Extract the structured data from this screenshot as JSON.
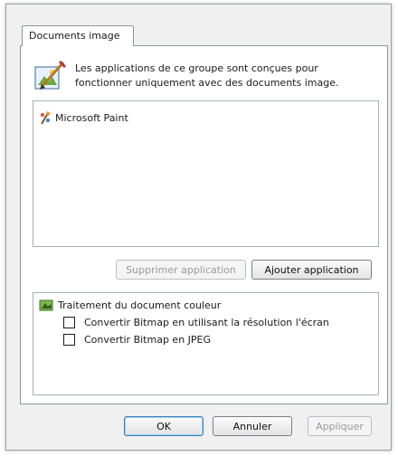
{
  "tab": {
    "label": "Documents image"
  },
  "description": "Les applications de ce groupe sont conçues pour fonctionner uniquement avec des documents image.",
  "app_list": {
    "items": [
      {
        "label": "Microsoft Paint",
        "icon": "paint-brush-icon"
      }
    ]
  },
  "buttons": {
    "remove_app": "Supprimer application",
    "add_app": "Ajouter application",
    "ok": "OK",
    "cancel": "Annuler",
    "apply": "Appliquer"
  },
  "features": {
    "heading": "Traitement du document couleur",
    "options": [
      {
        "label": "Convertir Bitmap en utilisant la résolution l'écran",
        "checked": false
      },
      {
        "label": "Convertir Bitmap en JPEG",
        "checked": false
      }
    ]
  },
  "colors": {
    "dialog_bg": "#f0f0f0",
    "panel_bg": "#ffffff",
    "border": "#8e959b",
    "default_button": "#3c7fb1"
  }
}
